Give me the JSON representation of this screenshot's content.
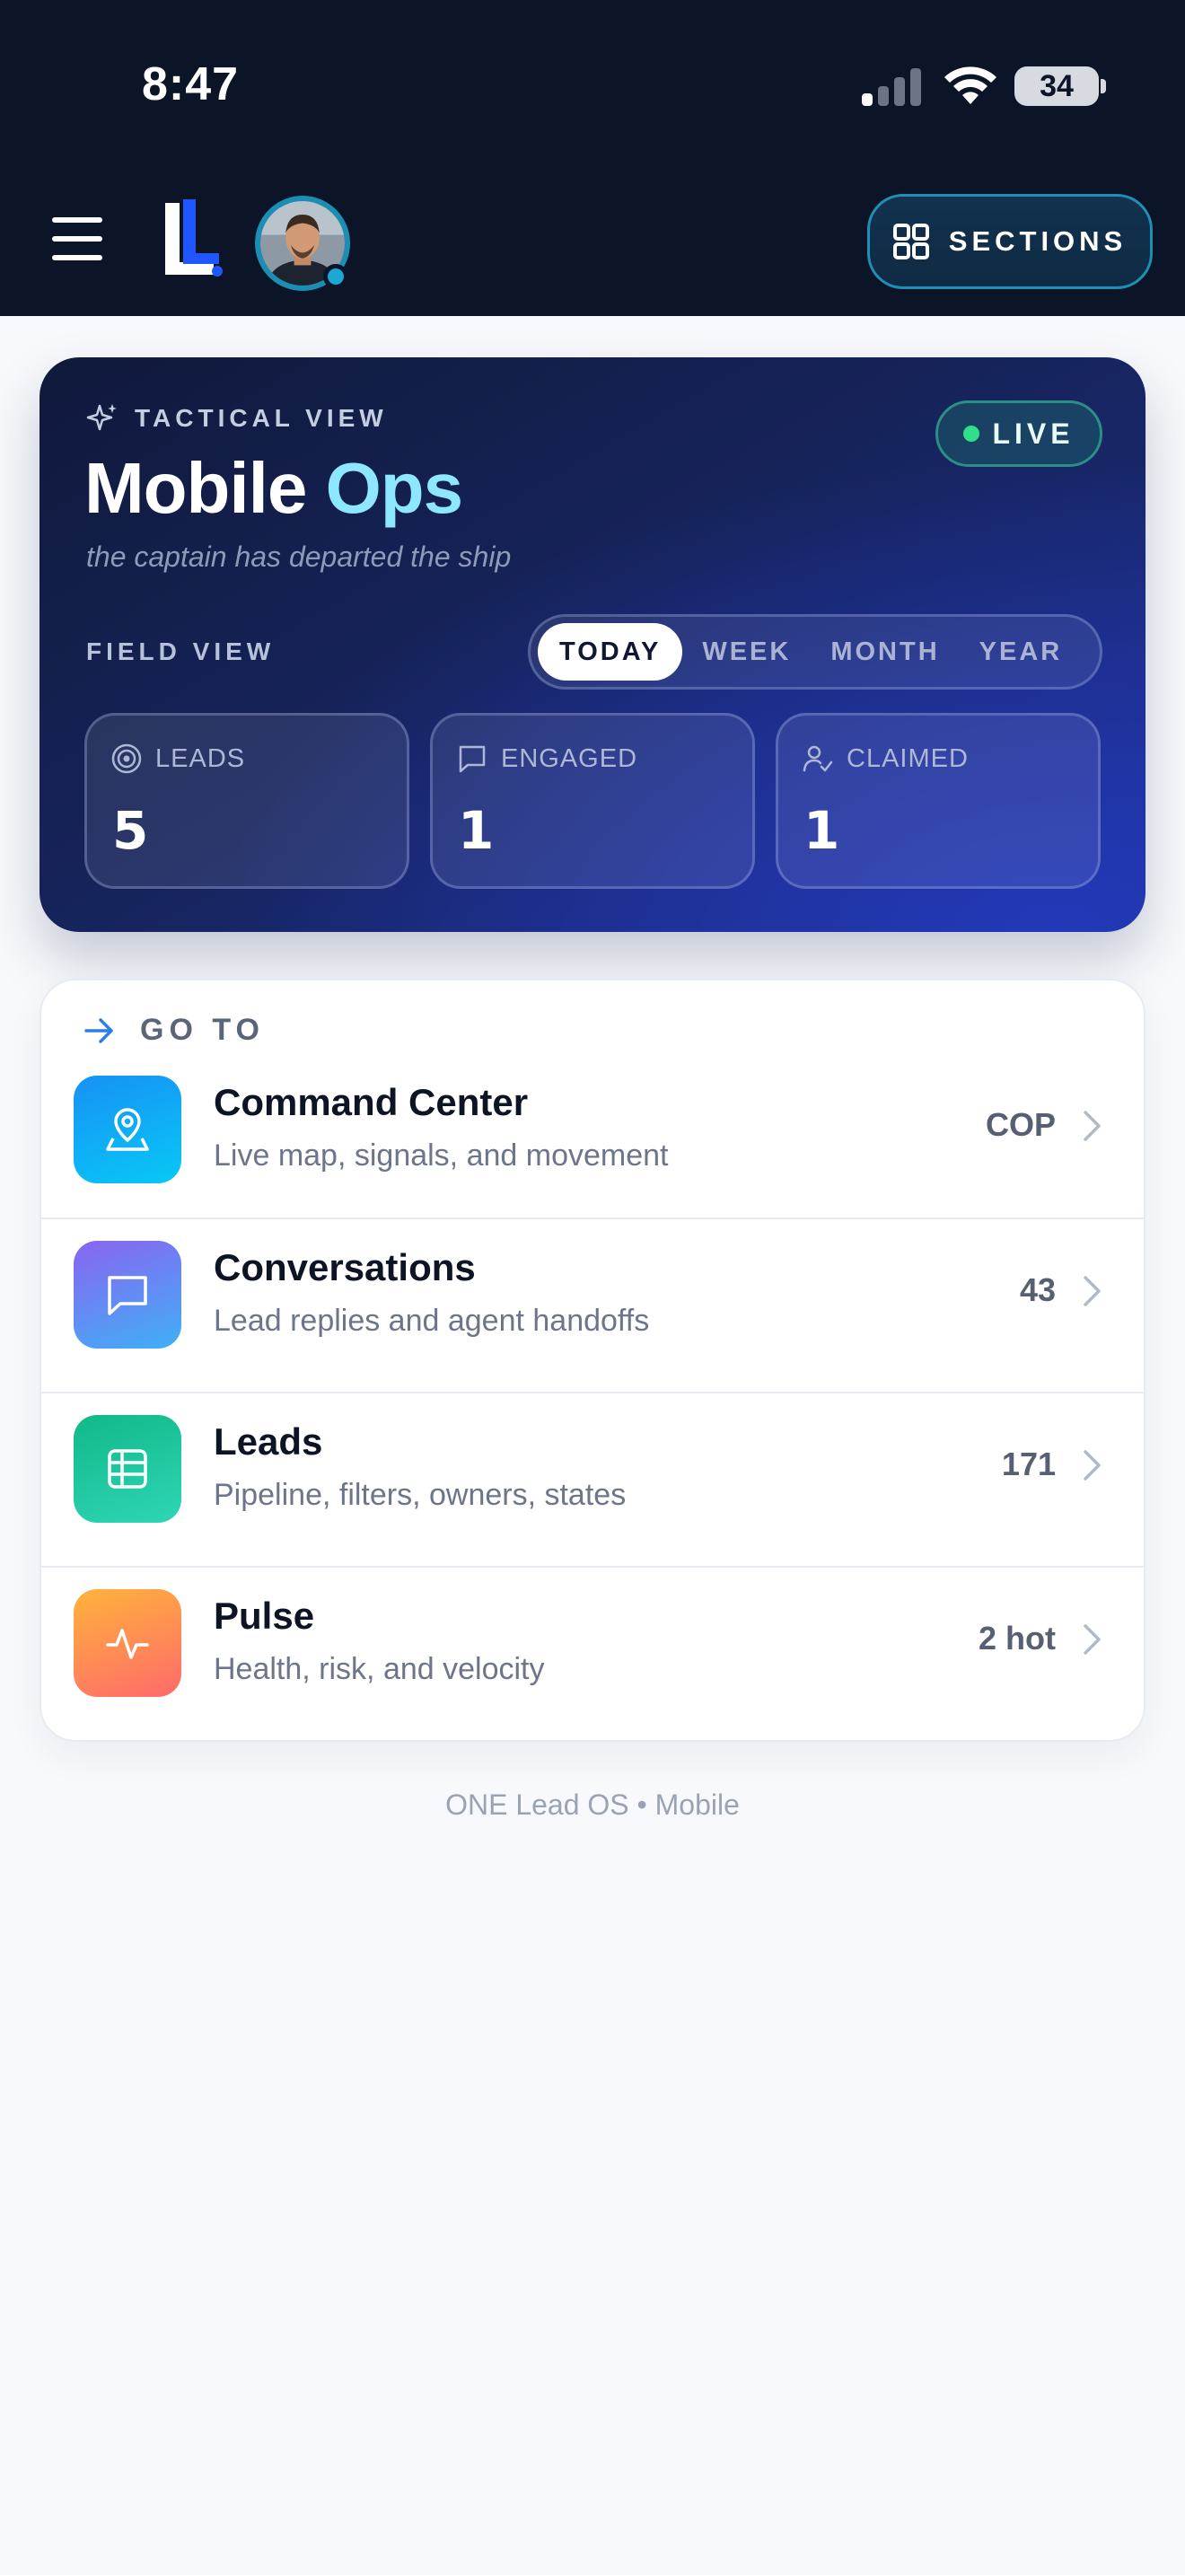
{
  "status_bar": {
    "time": "8:47",
    "battery": "34"
  },
  "header": {
    "menu_icon": "hamburger-icon",
    "logo_icon": "brand-logo",
    "avatar_icon": "user-avatar",
    "sections_label": "SECTIONS",
    "sections_icon": "grid-icon"
  },
  "hero": {
    "eyebrow": "TACTICAL VIEW",
    "title_main": "Mobile",
    "title_accent": "Ops",
    "subtitle": "the captain has departed the ship",
    "live_label": "LIVE",
    "field_label": "FIELD VIEW",
    "ranges": [
      {
        "label": "TODAY",
        "active": true
      },
      {
        "label": "WEEK",
        "active": false
      },
      {
        "label": "MONTH",
        "active": false
      },
      {
        "label": "YEAR",
        "active": false
      }
    ],
    "stats": [
      {
        "label": "LEADS",
        "value": "5",
        "icon": "target-icon"
      },
      {
        "label": "ENGAGED",
        "value": "1",
        "icon": "chat-icon"
      },
      {
        "label": "CLAIMED",
        "value": "1",
        "icon": "user-check-icon"
      }
    ]
  },
  "goto": {
    "heading": "GO TO",
    "items": [
      {
        "title": "Command Center",
        "subtitle": "Live map, signals, and movement",
        "meta": "COP",
        "icon": "map-pin-icon",
        "color": "#0ea5f0"
      },
      {
        "title": "Conversations",
        "subtitle": "Lead replies and agent handoffs",
        "meta": "43",
        "icon": "chat-icon",
        "color": "#7c6cf0"
      },
      {
        "title": "Leads",
        "subtitle": "Pipeline, filters, owners, states",
        "meta": "171",
        "icon": "table-icon",
        "color": "#1ec39a"
      },
      {
        "title": "Pulse",
        "subtitle": "Health, risk, and velocity",
        "meta": "2 hot",
        "icon": "activity-icon",
        "color": "#ff8a4c"
      }
    ]
  },
  "footer": "ONE Lead OS • Mobile"
}
